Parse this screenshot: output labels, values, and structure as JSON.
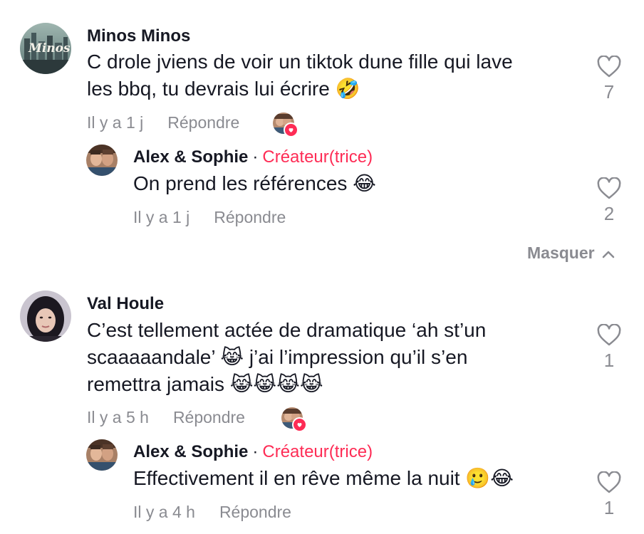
{
  "comments": [
    {
      "username": "Minos Minos",
      "avatar_text": "Minos",
      "text_lines": [
        "C drole jviens de voir un tiktok dune fille qui lave",
        "les bbq, tu devrais lui écrire 🤣"
      ],
      "time": "Il y a 1 j",
      "reply_label": "Répondre",
      "likes": "7",
      "liked_by_creator": true,
      "replies": [
        {
          "username": "Alex & Sophie",
          "separator": "·",
          "badge": "Créateur(trice)",
          "text_lines": [
            "On prend les références 😂"
          ],
          "time": "Il y a 1 j",
          "reply_label": "Répondre",
          "likes": "2"
        }
      ],
      "collapse_label": "Masquer"
    },
    {
      "username": "Val Houle",
      "text_lines": [
        "C’est tellement actée de dramatique ‘ah st’un",
        "scaaaaandale’ 😹 j’ai l’impression qu’il s’en",
        "remettra jamais 😹😹😹😹"
      ],
      "time": "Il y a 5 h",
      "reply_label": "Répondre",
      "likes": "1",
      "liked_by_creator": true,
      "replies": [
        {
          "username": "Alex & Sophie",
          "separator": "·",
          "badge": "Créateur(trice)",
          "text_lines": [
            "Effectivement il en rêve même la nuit 🥲😂"
          ],
          "time": "Il y a 4 h",
          "reply_label": "Répondre",
          "likes": "1"
        }
      ]
    }
  ],
  "colors": {
    "text": "#161823",
    "secondary": "#8a8b91",
    "creator_badge": "#fe2c55",
    "like_badge": "#fe2c55"
  }
}
